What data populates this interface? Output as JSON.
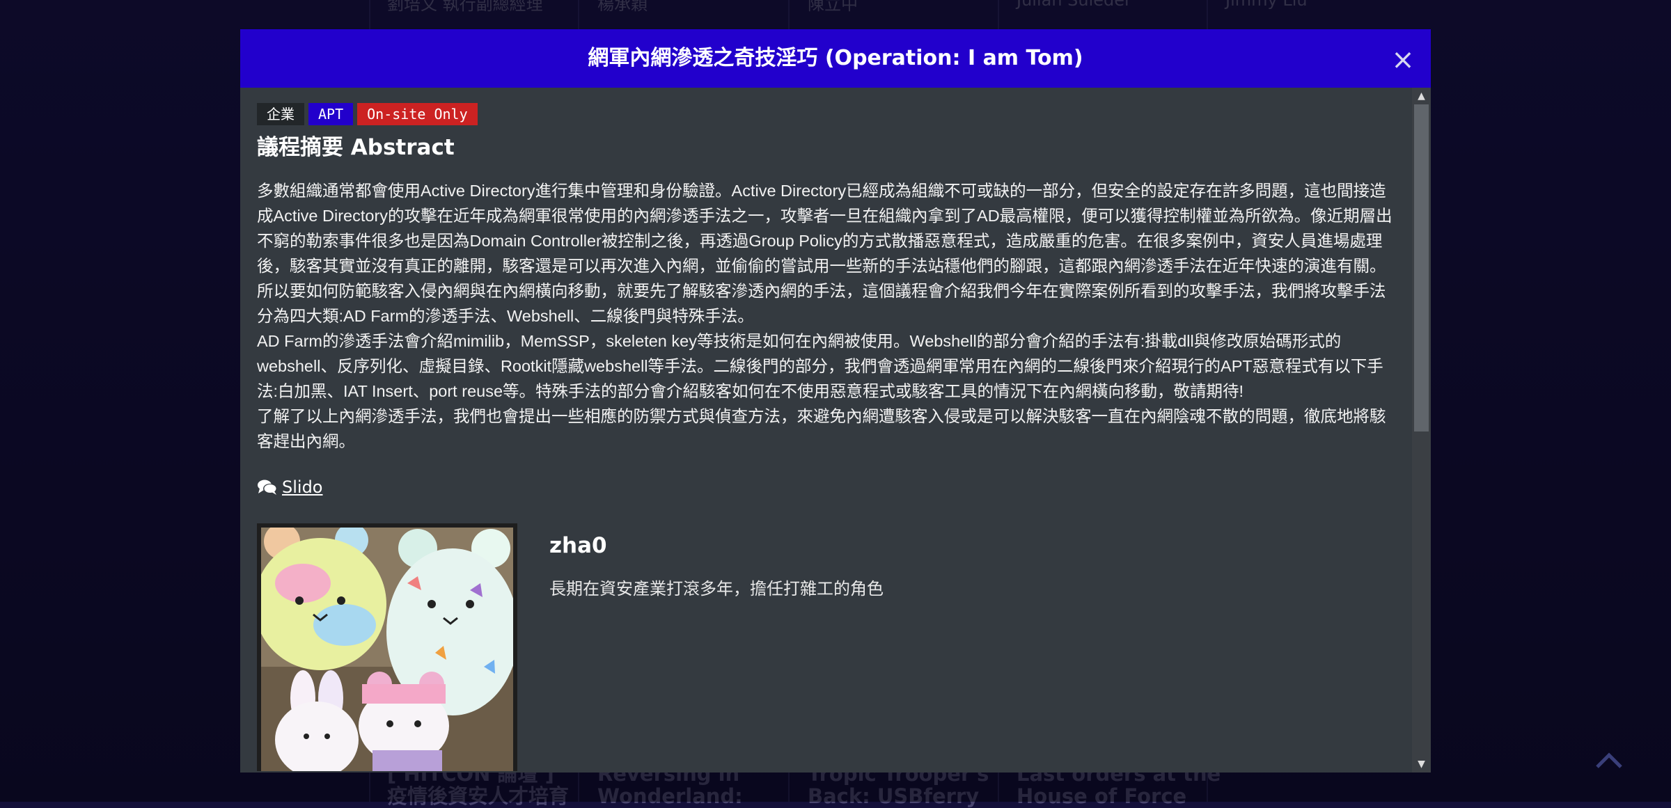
{
  "background": {
    "top_names": [
      "劉培文 執行副總經理",
      "楊承穎",
      "陳立中",
      "Julian Suleder",
      "Jimmy Liu"
    ],
    "card_titles": [
      "[ HITCON 論壇 ]\n疫情後資安人才培育",
      "Reversing in\nWonderland:",
      "Tropic Trooper's\nBack: USBferry",
      "Last orders at the\nHouse of Force"
    ]
  },
  "modal": {
    "title": "網軍內網滲透之奇技淫巧 (Operation: I am Tom)",
    "close_label": "×",
    "tags": [
      {
        "label": "企業",
        "color": "#222629"
      },
      {
        "label": "APT",
        "color": "#2200cc"
      },
      {
        "label": "On-site Only",
        "color": "#cc2222"
      }
    ],
    "abstract_heading": "議程摘要 Abstract",
    "abstract_paragraphs": [
      "多數組織通常都會使用Active Directory進行集中管理和身份驗證。Active Directory已經成為組織不可或缺的一部分，但安全的設定存在許多問題，這也間接造成Active Directory的攻擊在近年成為網軍很常使用的內網滲透手法之一，攻擊者一旦在組織內拿到了AD最高權限，便可以獲得控制權並為所欲為。像近期層出不窮的勒索事件很多也是因為Domain Controller被控制之後，再透過Group Policy的方式散播惡意程式，造成嚴重的危害。在很多案例中，資安人員進場處理後，駭客其實並沒有真正的離開，駭客還是可以再次進入內網，並偷偷的嘗試用一些新的手法站穩他們的腳跟，這都跟內網滲透手法在近年快速的演進有關。所以要如何防範駭客入侵內網與在內網橫向移動，就要先了解駭客滲透內網的手法，這個議程會介紹我們今年在實際案例所看到的攻擊手法，我們將攻擊手法分為四大類:AD Farm的滲透手法、Webshell、二線後門與特殊手法。",
      "AD Farm的滲透手法會介紹mimilib，MemSSP，skeleten key等技術是如何在內網被使用。Webshell的部分會介紹的手法有:掛載dll與修改原始碼形式的webshell、反序列化、虛擬目錄、Rootkit隱藏webshell等手法。二線後門的部分，我們會透過網軍常用在內網的二線後門來介紹現行的APT惡意程式有以下手法:白加黑、IAT Insert、port reuse等。特殊手法的部分會介紹駭客如何在不使用惡意程式或駭客工具的情況下在內網橫向移動，敬請期待!",
      "了解了以上內網滲透手法，我們也會提出一些相應的防禦方式與偵查方法，來避免內網遭駭客入侵或是可以解決駭客一直在內網陰魂不散的問題，徹底地將駭客趕出內網。"
    ],
    "slido_label": "Slido",
    "speaker": {
      "name": "zha0",
      "bio": "長期在資安產業打滾多年，擔任打雜工的角色"
    }
  }
}
